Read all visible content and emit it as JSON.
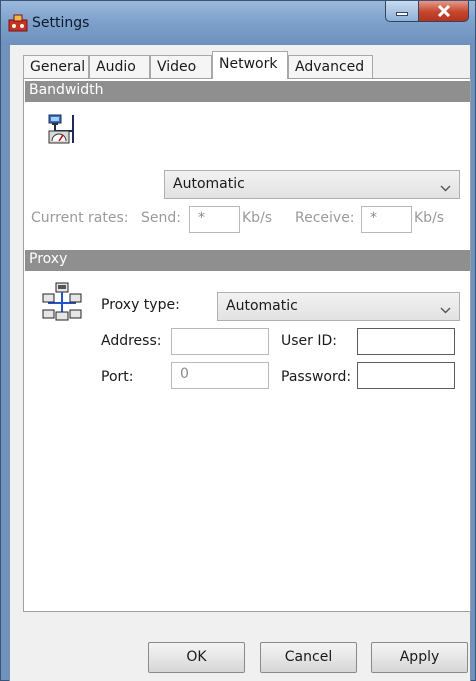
{
  "window": {
    "title": "Settings"
  },
  "tabs": [
    {
      "label": "General"
    },
    {
      "label": "Audio"
    },
    {
      "label": "Video"
    },
    {
      "label": "Network",
      "active": true
    },
    {
      "label": "Advanced"
    }
  ],
  "bandwidth": {
    "header": "Bandwidth",
    "mode_value": "Automatic",
    "current_rates_label": "Current rates:",
    "send_label": "Send:",
    "send_value": "*",
    "send_unit": "Kb/s",
    "receive_label": "Receive:",
    "receive_value": "*",
    "receive_unit": "Kb/s"
  },
  "proxy": {
    "header": "Proxy",
    "type_label": "Proxy type:",
    "type_value": "Automatic",
    "address_label": "Address:",
    "address_value": "",
    "user_id_label": "User ID:",
    "user_id_value": "",
    "port_label": "Port:",
    "port_value": "0",
    "password_label": "Password:",
    "password_value": ""
  },
  "buttons": {
    "ok": "OK",
    "cancel": "Cancel",
    "apply": "Apply"
  },
  "icons": {
    "app": "app-icon",
    "minimize": "minimize-icon",
    "close": "close-icon",
    "bandwidth": "network-meter-icon",
    "proxy": "network-tree-icon",
    "dropdown": "chevron-down-icon"
  },
  "colors": {
    "titlebar": "#7fa2cc",
    "close_button": "#c4452d",
    "section_header": "#8f8f8f"
  }
}
